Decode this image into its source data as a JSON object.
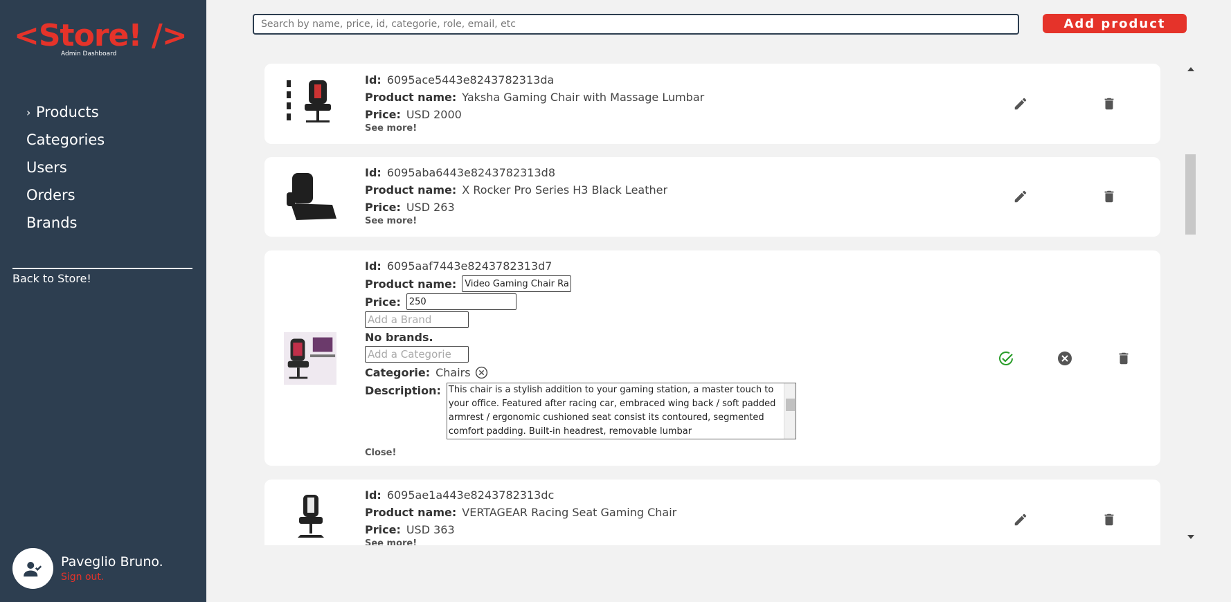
{
  "sidebar": {
    "logo_main": "<Store! />",
    "logo_sub": "Admin Dashboard",
    "nav": [
      {
        "label": "Products",
        "active": true
      },
      {
        "label": "Categories"
      },
      {
        "label": "Users"
      },
      {
        "label": "Orders"
      },
      {
        "label": "Brands"
      }
    ],
    "back_link": "Back to Store!",
    "user": {
      "name": "Paveglio Bruno.",
      "sign_out": "Sign out."
    }
  },
  "topbar": {
    "search_placeholder": "Search by name, price, id, categorie, role, email, etc",
    "add_button": "Add product"
  },
  "labels": {
    "id": "Id:",
    "name": "Product name:",
    "price": "Price:",
    "categorie": "Categorie:",
    "description": "Description:",
    "see_more": "See more!",
    "close": "Close!",
    "no_brands": "No brands."
  },
  "products": [
    {
      "id": "6095ace5443e8243782313da",
      "name": "Yaksha Gaming Chair with Massage Lumbar",
      "price": "USD 2000"
    },
    {
      "id": "6095aba6443e8243782313d8",
      "name": "X Rocker Pro Series H3 Black Leather",
      "price": "USD 263"
    },
    {
      "id": "6095aaf7443e8243782313d7",
      "editing": true,
      "name_value": "Video Gaming Chair Ra",
      "price_value": "250",
      "brand_placeholder": "Add a Brand",
      "categorie_placeholder": "Add a Categorie",
      "categorie": "Chairs",
      "description": "This chair is a stylish addition to your gaming station, a master touch to your office. Featured after racing car, embraced wing back / soft padded armrest / ergonomic cushioned seat consist its contoured, segmented comfort padding. Built-in headrest, removable lumbar"
    },
    {
      "id": "6095ae1a443e8243782313dc",
      "name": "VERTAGEAR Racing Seat Gaming Chair",
      "price": "USD 363"
    }
  ],
  "colors": {
    "sidebar_bg": "#2d3e50",
    "accent": "#e5332a",
    "confirm": "#2a9d2a",
    "icon": "#555555"
  }
}
